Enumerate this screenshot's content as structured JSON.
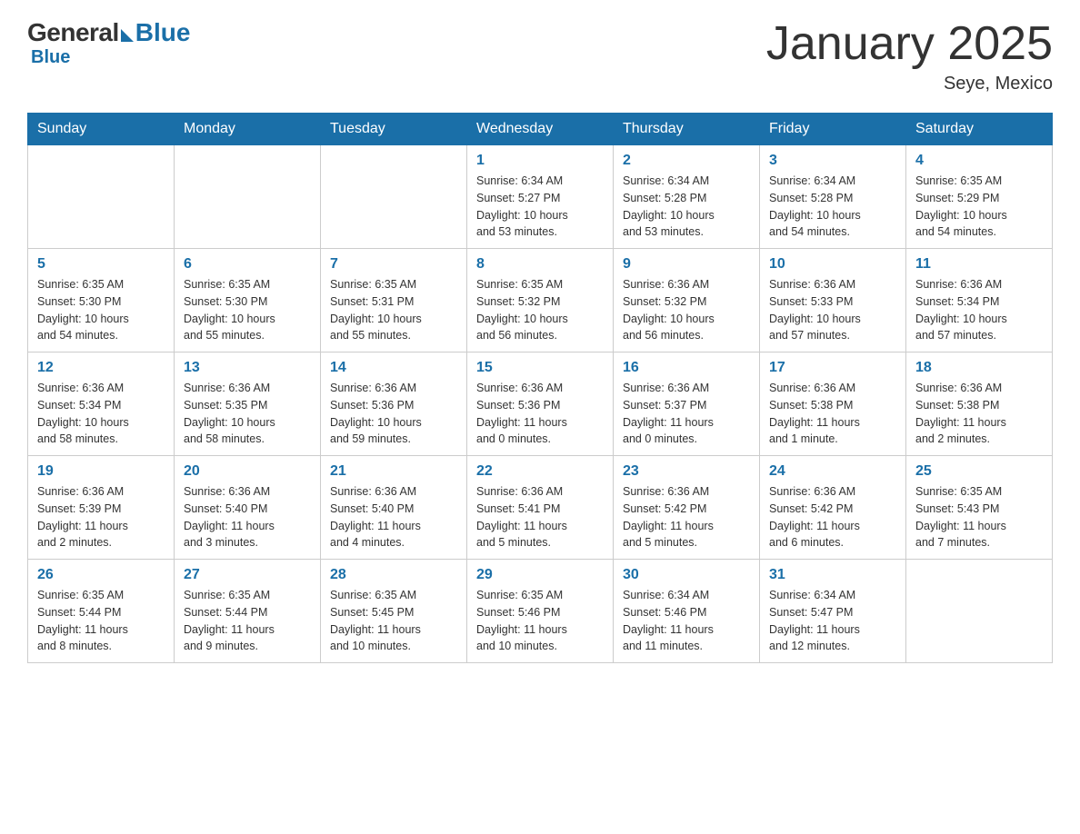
{
  "logo": {
    "general": "General",
    "blue": "Blue"
  },
  "header": {
    "title": "January 2025",
    "location": "Seye, Mexico"
  },
  "weekdays": [
    "Sunday",
    "Monday",
    "Tuesday",
    "Wednesday",
    "Thursday",
    "Friday",
    "Saturday"
  ],
  "weeks": [
    [
      {
        "day": "",
        "info": ""
      },
      {
        "day": "",
        "info": ""
      },
      {
        "day": "",
        "info": ""
      },
      {
        "day": "1",
        "info": "Sunrise: 6:34 AM\nSunset: 5:27 PM\nDaylight: 10 hours\nand 53 minutes."
      },
      {
        "day": "2",
        "info": "Sunrise: 6:34 AM\nSunset: 5:28 PM\nDaylight: 10 hours\nand 53 minutes."
      },
      {
        "day": "3",
        "info": "Sunrise: 6:34 AM\nSunset: 5:28 PM\nDaylight: 10 hours\nand 54 minutes."
      },
      {
        "day": "4",
        "info": "Sunrise: 6:35 AM\nSunset: 5:29 PM\nDaylight: 10 hours\nand 54 minutes."
      }
    ],
    [
      {
        "day": "5",
        "info": "Sunrise: 6:35 AM\nSunset: 5:30 PM\nDaylight: 10 hours\nand 54 minutes."
      },
      {
        "day": "6",
        "info": "Sunrise: 6:35 AM\nSunset: 5:30 PM\nDaylight: 10 hours\nand 55 minutes."
      },
      {
        "day": "7",
        "info": "Sunrise: 6:35 AM\nSunset: 5:31 PM\nDaylight: 10 hours\nand 55 minutes."
      },
      {
        "day": "8",
        "info": "Sunrise: 6:35 AM\nSunset: 5:32 PM\nDaylight: 10 hours\nand 56 minutes."
      },
      {
        "day": "9",
        "info": "Sunrise: 6:36 AM\nSunset: 5:32 PM\nDaylight: 10 hours\nand 56 minutes."
      },
      {
        "day": "10",
        "info": "Sunrise: 6:36 AM\nSunset: 5:33 PM\nDaylight: 10 hours\nand 57 minutes."
      },
      {
        "day": "11",
        "info": "Sunrise: 6:36 AM\nSunset: 5:34 PM\nDaylight: 10 hours\nand 57 minutes."
      }
    ],
    [
      {
        "day": "12",
        "info": "Sunrise: 6:36 AM\nSunset: 5:34 PM\nDaylight: 10 hours\nand 58 minutes."
      },
      {
        "day": "13",
        "info": "Sunrise: 6:36 AM\nSunset: 5:35 PM\nDaylight: 10 hours\nand 58 minutes."
      },
      {
        "day": "14",
        "info": "Sunrise: 6:36 AM\nSunset: 5:36 PM\nDaylight: 10 hours\nand 59 minutes."
      },
      {
        "day": "15",
        "info": "Sunrise: 6:36 AM\nSunset: 5:36 PM\nDaylight: 11 hours\nand 0 minutes."
      },
      {
        "day": "16",
        "info": "Sunrise: 6:36 AM\nSunset: 5:37 PM\nDaylight: 11 hours\nand 0 minutes."
      },
      {
        "day": "17",
        "info": "Sunrise: 6:36 AM\nSunset: 5:38 PM\nDaylight: 11 hours\nand 1 minute."
      },
      {
        "day": "18",
        "info": "Sunrise: 6:36 AM\nSunset: 5:38 PM\nDaylight: 11 hours\nand 2 minutes."
      }
    ],
    [
      {
        "day": "19",
        "info": "Sunrise: 6:36 AM\nSunset: 5:39 PM\nDaylight: 11 hours\nand 2 minutes."
      },
      {
        "day": "20",
        "info": "Sunrise: 6:36 AM\nSunset: 5:40 PM\nDaylight: 11 hours\nand 3 minutes."
      },
      {
        "day": "21",
        "info": "Sunrise: 6:36 AM\nSunset: 5:40 PM\nDaylight: 11 hours\nand 4 minutes."
      },
      {
        "day": "22",
        "info": "Sunrise: 6:36 AM\nSunset: 5:41 PM\nDaylight: 11 hours\nand 5 minutes."
      },
      {
        "day": "23",
        "info": "Sunrise: 6:36 AM\nSunset: 5:42 PM\nDaylight: 11 hours\nand 5 minutes."
      },
      {
        "day": "24",
        "info": "Sunrise: 6:36 AM\nSunset: 5:42 PM\nDaylight: 11 hours\nand 6 minutes."
      },
      {
        "day": "25",
        "info": "Sunrise: 6:35 AM\nSunset: 5:43 PM\nDaylight: 11 hours\nand 7 minutes."
      }
    ],
    [
      {
        "day": "26",
        "info": "Sunrise: 6:35 AM\nSunset: 5:44 PM\nDaylight: 11 hours\nand 8 minutes."
      },
      {
        "day": "27",
        "info": "Sunrise: 6:35 AM\nSunset: 5:44 PM\nDaylight: 11 hours\nand 9 minutes."
      },
      {
        "day": "28",
        "info": "Sunrise: 6:35 AM\nSunset: 5:45 PM\nDaylight: 11 hours\nand 10 minutes."
      },
      {
        "day": "29",
        "info": "Sunrise: 6:35 AM\nSunset: 5:46 PM\nDaylight: 11 hours\nand 10 minutes."
      },
      {
        "day": "30",
        "info": "Sunrise: 6:34 AM\nSunset: 5:46 PM\nDaylight: 11 hours\nand 11 minutes."
      },
      {
        "day": "31",
        "info": "Sunrise: 6:34 AM\nSunset: 5:47 PM\nDaylight: 11 hours\nand 12 minutes."
      },
      {
        "day": "",
        "info": ""
      }
    ]
  ]
}
